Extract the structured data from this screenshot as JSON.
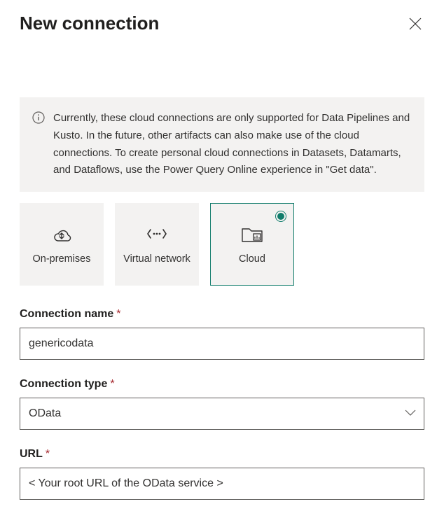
{
  "header": {
    "title": "New connection"
  },
  "info": {
    "text": "Currently, these cloud connections are only supported for Data Pipelines and Kusto. In the future, other artifacts can also make use of the cloud connections. To create personal cloud connections in Datasets, Datamarts, and Dataflows, use the Power Query Online experience in \"Get data\"."
  },
  "connection_types": {
    "items": [
      {
        "label": "On-premises",
        "selected": false
      },
      {
        "label": "Virtual network",
        "selected": false
      },
      {
        "label": "Cloud",
        "selected": true
      }
    ]
  },
  "fields": {
    "connection_name": {
      "label": "Connection name",
      "required_mark": "*",
      "value": "genericodata"
    },
    "connection_type": {
      "label": "Connection type",
      "required_mark": "*",
      "value": "OData"
    },
    "url": {
      "label": "URL",
      "required_mark": "*",
      "value": "< Your root URL of the OData service >"
    }
  }
}
